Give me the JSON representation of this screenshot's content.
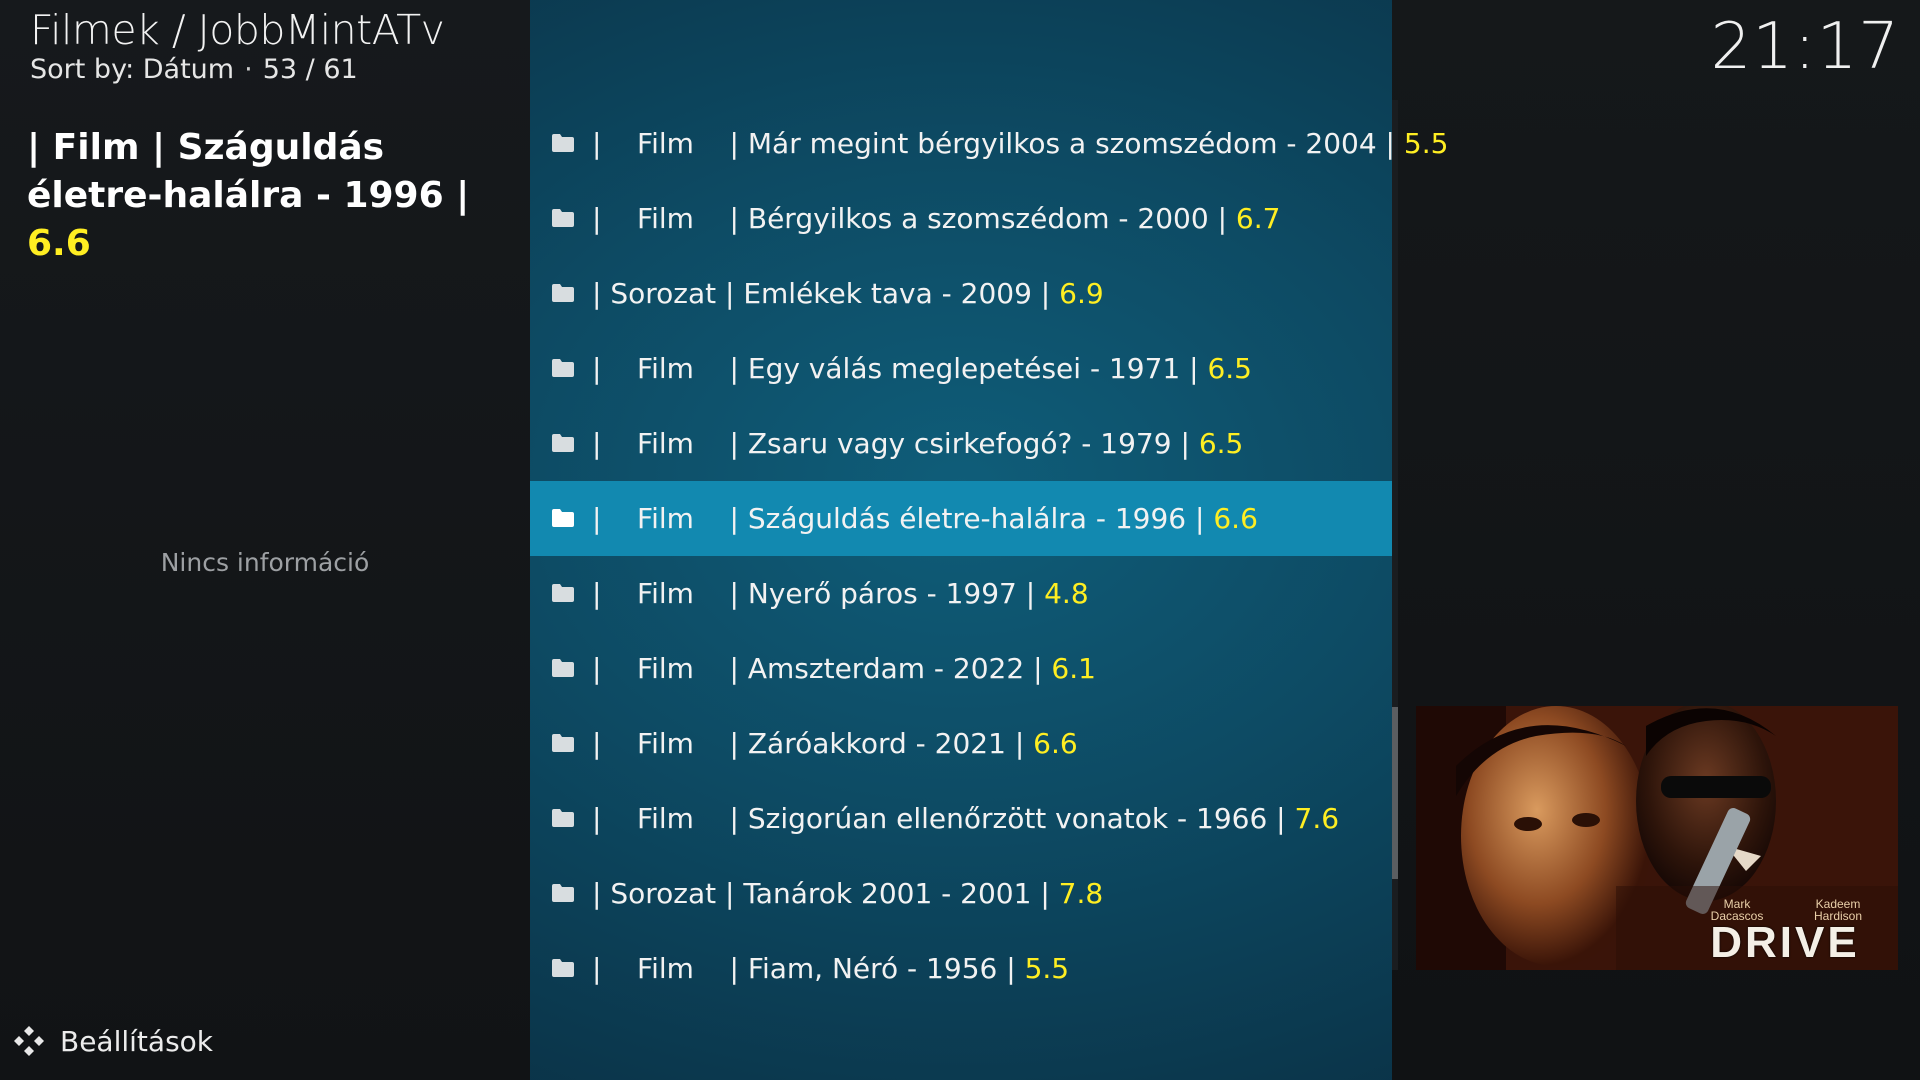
{
  "header": {
    "title": "Filmek / JobbMintATv",
    "sort_label": "Sort by: Dátum",
    "separator": "·",
    "position": "53 / 61"
  },
  "clock": "21:17",
  "info": {
    "title_prefix": "| Film | Száguldás életre-halálra - 1996 |",
    "rating": "6.6",
    "no_info": "Nincs információ"
  },
  "settings": {
    "label": "Beállítások"
  },
  "list": {
    "items": [
      {
        "label": "|    Film    | Már megint bérgyilkos a szomszédom - 2004 | ",
        "score": "5.5",
        "focused": false
      },
      {
        "label": "|    Film    | Bérgyilkos a szomszédom - 2000 | ",
        "score": "6.7",
        "focused": false
      },
      {
        "label": "| Sorozat | Emlékek tava - 2009 | ",
        "score": "6.9",
        "focused": false
      },
      {
        "label": "|    Film    | Egy válás meglepetései - 1971 | ",
        "score": "6.5",
        "focused": false
      },
      {
        "label": "|    Film    | Zsaru vagy csirkefogó? - 1979 | ",
        "score": "6.5",
        "focused": false
      },
      {
        "label": "|    Film    | Száguldás életre-halálra - 1996 | ",
        "score": "6.6",
        "focused": true
      },
      {
        "label": "|    Film    | Nyerő páros - 1997 | ",
        "score": "4.8",
        "focused": false
      },
      {
        "label": "|    Film    | Amszterdam - 2022 | ",
        "score": "6.1",
        "focused": false
      },
      {
        "label": "|    Film    | Záróakkord - 2021 | ",
        "score": "6.6",
        "focused": false
      },
      {
        "label": "|    Film    | Szigorúan ellenőrzött vonatok - 1966 | ",
        "score": "7.6",
        "focused": false
      },
      {
        "label": "| Sorozat | Tanárok 2001 - 2001 | ",
        "score": "7.8",
        "focused": false
      },
      {
        "label": "|    Film    | Fiam, Néró - 1956 | ",
        "score": "5.5",
        "focused": false
      }
    ]
  },
  "scroll_position": 0.87,
  "poster": {
    "credit_1_first": "Mark",
    "credit_1_last": "Dacascos",
    "credit_2_first": "Kadeem",
    "credit_2_last": "Hardison",
    "title": "DRIVE"
  },
  "colors": {
    "accent_focus": "#1289b0",
    "rating_yellow": "#ffee22",
    "panel_blue": "#0d4a63"
  }
}
